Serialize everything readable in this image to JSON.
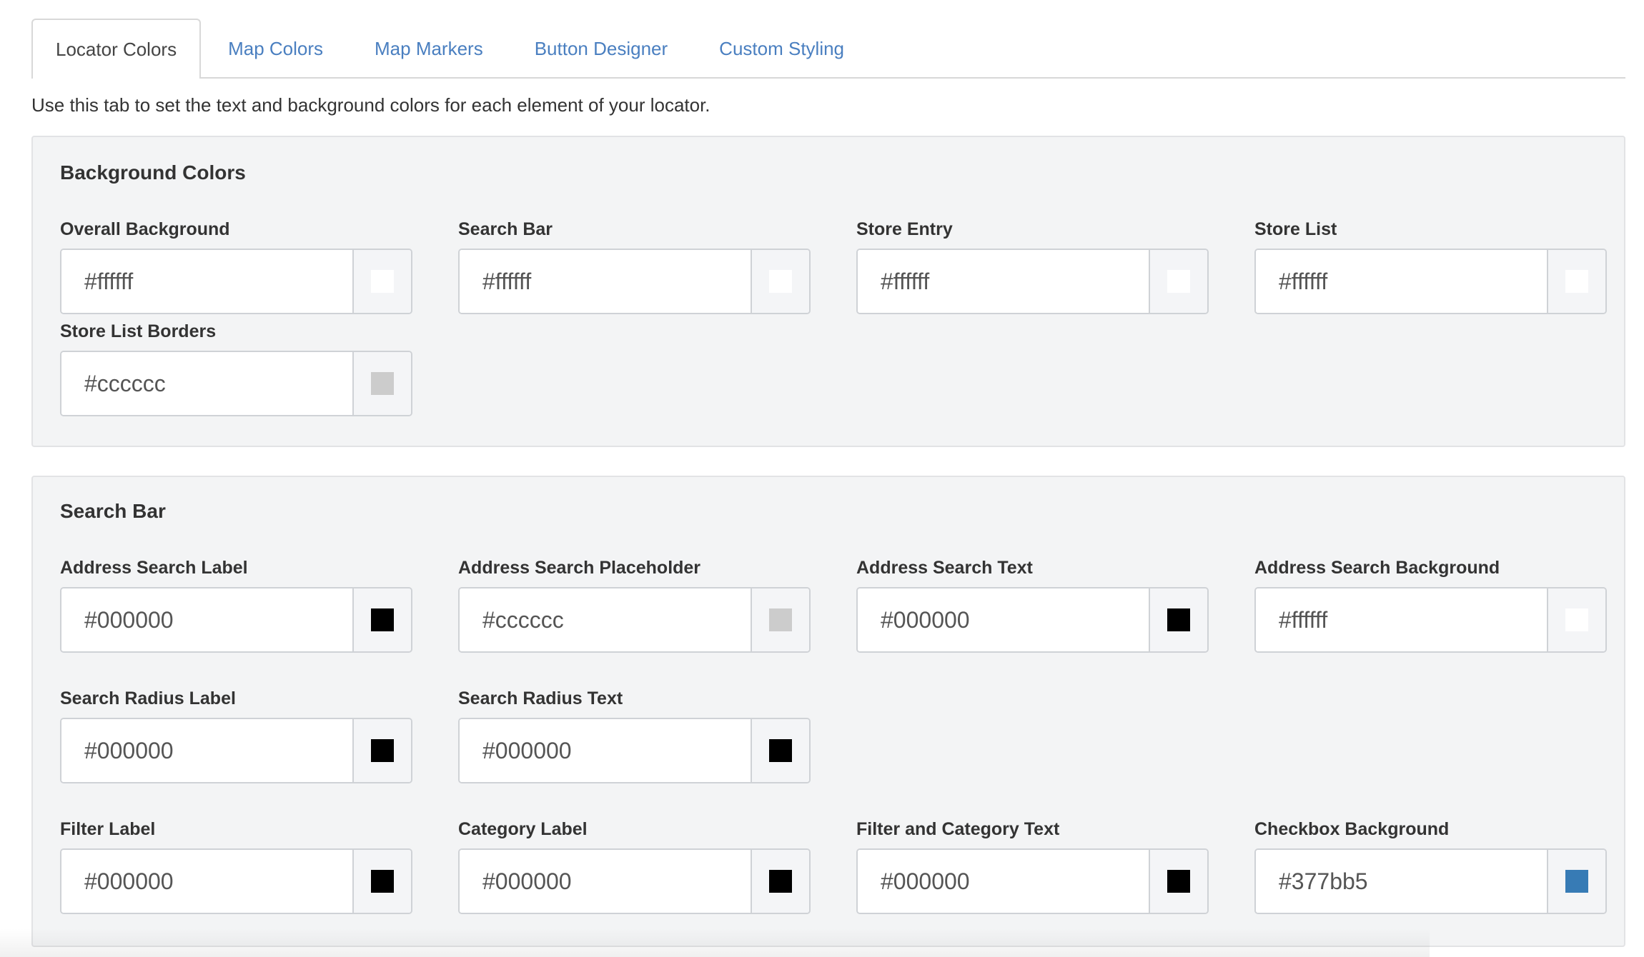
{
  "tabs": [
    {
      "label": "Locator Colors",
      "active": true
    },
    {
      "label": "Map Colors",
      "active": false
    },
    {
      "label": "Map Markers",
      "active": false
    },
    {
      "label": "Button Designer",
      "active": false
    },
    {
      "label": "Custom Styling",
      "active": false
    }
  ],
  "intro": "Use this tab to set the text and background colors for each element of your locator.",
  "sections": {
    "background": {
      "title": "Background Colors",
      "fields": [
        {
          "label": "Overall Background",
          "value": "#ffffff",
          "swatch": "#ffffff"
        },
        {
          "label": "Search Bar",
          "value": "#ffffff",
          "swatch": "#ffffff"
        },
        {
          "label": "Store Entry",
          "value": "#ffffff",
          "swatch": "#ffffff"
        },
        {
          "label": "Store List",
          "value": "#ffffff",
          "swatch": "#ffffff"
        },
        {
          "label": "Store List Borders",
          "value": "#cccccc",
          "swatch": "#cccccc"
        }
      ]
    },
    "search_bar": {
      "title": "Search Bar",
      "fields": [
        {
          "label": "Address Search Label",
          "value": "#000000",
          "swatch": "#000000"
        },
        {
          "label": "Address Search Placeholder",
          "value": "#cccccc",
          "swatch": "#cccccc"
        },
        {
          "label": "Address Search Text",
          "value": "#000000",
          "swatch": "#000000"
        },
        {
          "label": "Address Search Background",
          "value": "#ffffff",
          "swatch": "#ffffff"
        },
        {
          "label": "Search Radius Label",
          "value": "#000000",
          "swatch": "#000000"
        },
        {
          "label": "Search Radius Text",
          "value": "#000000",
          "swatch": "#000000"
        },
        {
          "label": "Filter Label",
          "value": "#000000",
          "swatch": "#000000"
        },
        {
          "label": "Category Label",
          "value": "#000000",
          "swatch": "#000000"
        },
        {
          "label": "Filter and Category Text",
          "value": "#000000",
          "swatch": "#000000"
        },
        {
          "label": "Checkbox Background",
          "value": "#377bb5",
          "swatch": "#377bb5"
        }
      ]
    }
  }
}
